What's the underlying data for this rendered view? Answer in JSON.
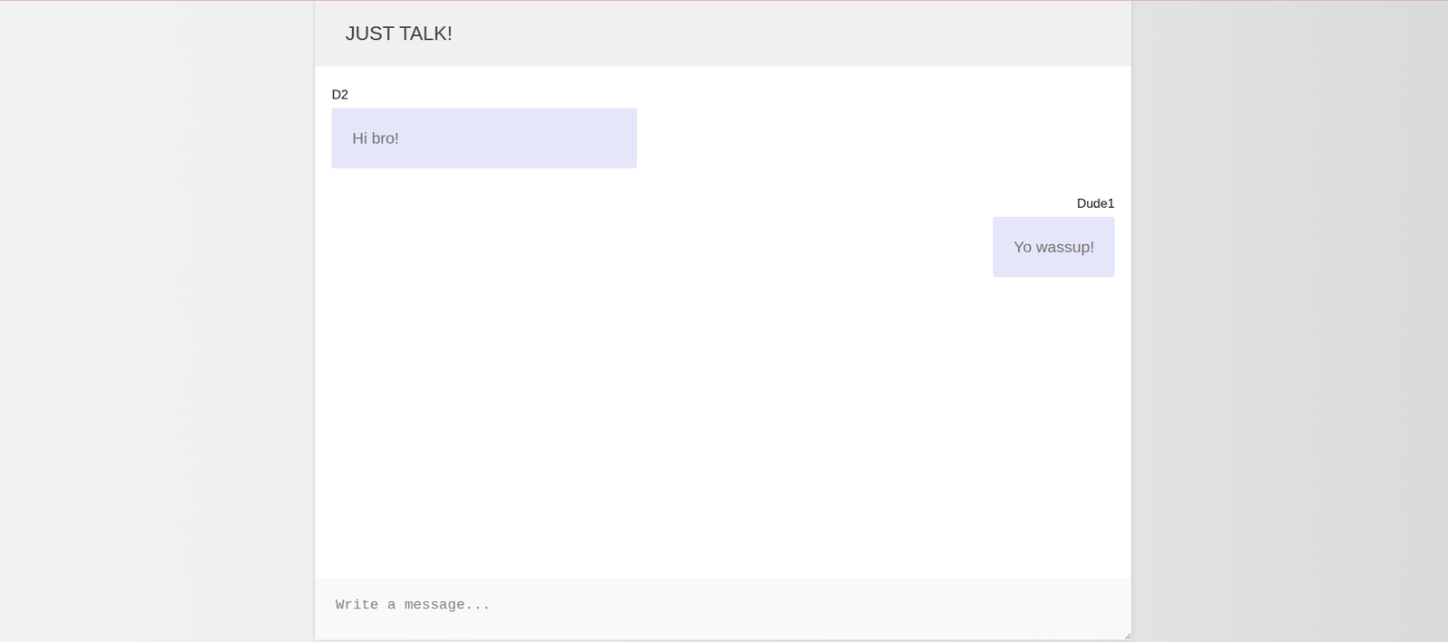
{
  "window": {
    "title": "JUST TALK!"
  },
  "messages": [
    {
      "author": "D2",
      "text": "Hi bro!",
      "own": false
    },
    {
      "author": "Dude1",
      "text": "Yo wassup!",
      "own": true
    }
  ],
  "composer": {
    "placeholder": "Write a message..."
  }
}
